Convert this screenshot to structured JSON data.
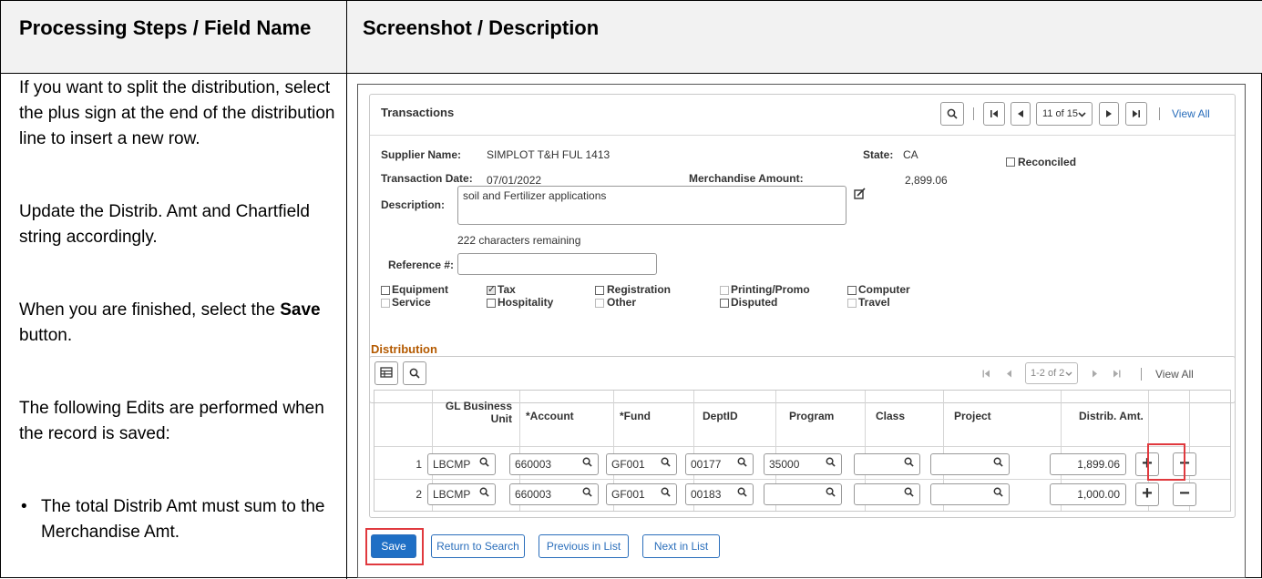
{
  "header": {
    "left": "Processing Steps / Field Name",
    "right": "Screenshot / Description"
  },
  "instructions": {
    "p1": "If you want to split the distribution, select the plus sign at the end of the distribution line to insert a new row.",
    "p2": "Update the Distrib. Amt and Chartfield string accordingly.",
    "p3_pre": "When you are finished, select the",
    "p3_bold": "Save",
    "p3_post": "button.",
    "p4": "The following Edits are performed when the record is saved:",
    "bullets": [
      "The total Distrib Amt must sum to the Merchandise Amt."
    ]
  },
  "transactions": {
    "title": "Transactions",
    "pager": "11 of 15",
    "view_all": "View All",
    "supplier_label": "Supplier Name:",
    "supplier_value": "SIMPLOT T&H FUL 1413",
    "state_label": "State:",
    "state_value": "CA",
    "reconciled_label": "Reconciled",
    "date_label": "Transaction Date:",
    "date_value": "07/01/2022",
    "merch_label": "Merchandise Amount:",
    "merch_value": "2,899.06",
    "desc_label": "Description:",
    "desc_value": "soil and Fertilizer applications",
    "chars_remaining": "222 characters remaining",
    "ref_label": "Reference #:",
    "ref_value": "",
    "checkboxes": [
      {
        "label": "Equipment",
        "checked": false,
        "enabled": true
      },
      {
        "label": "Tax",
        "checked": true,
        "enabled": true
      },
      {
        "label": "Registration",
        "checked": false,
        "enabled": true
      },
      {
        "label": "Printing/Promo",
        "checked": false,
        "enabled": false
      },
      {
        "label": "Computer",
        "checked": false,
        "enabled": true
      },
      {
        "label": "Service",
        "checked": false,
        "enabled": false
      },
      {
        "label": "Hospitality",
        "checked": false,
        "enabled": true
      },
      {
        "label": "Other",
        "checked": false,
        "enabled": false
      },
      {
        "label": "Disputed",
        "checked": false,
        "enabled": true
      },
      {
        "label": "Travel",
        "checked": false,
        "enabled": false
      }
    ]
  },
  "distribution": {
    "title": "Distribution",
    "pager": "1-2 of 2",
    "view_all": "View All",
    "columns": [
      "GL Business Unit",
      "*Account",
      "*Fund",
      "DeptID",
      "Program",
      "Class",
      "Project",
      "Distrib. Amt."
    ],
    "col_gl_1": "GL Business",
    "col_gl_2": "Unit",
    "rows": [
      {
        "num": "1",
        "bu": "LBCMP",
        "account": "660003",
        "fund": "GF001",
        "dept": "00177",
        "program": "35000",
        "class": "",
        "project": "",
        "amount": "1,899.06"
      },
      {
        "num": "2",
        "bu": "LBCMP",
        "account": "660003",
        "fund": "GF001",
        "dept": "00183",
        "program": "",
        "class": "",
        "project": "",
        "amount": "1,000.00"
      }
    ],
    "add_symbol": "+",
    "remove_symbol": "−"
  },
  "buttons": {
    "save": "Save",
    "return": "Return to Search",
    "previous": "Previous in List",
    "next": "Next in List"
  },
  "colors": {
    "accent": "#1f6fc5",
    "highlight": "#e0393e",
    "section_title": "#b45a00"
  }
}
